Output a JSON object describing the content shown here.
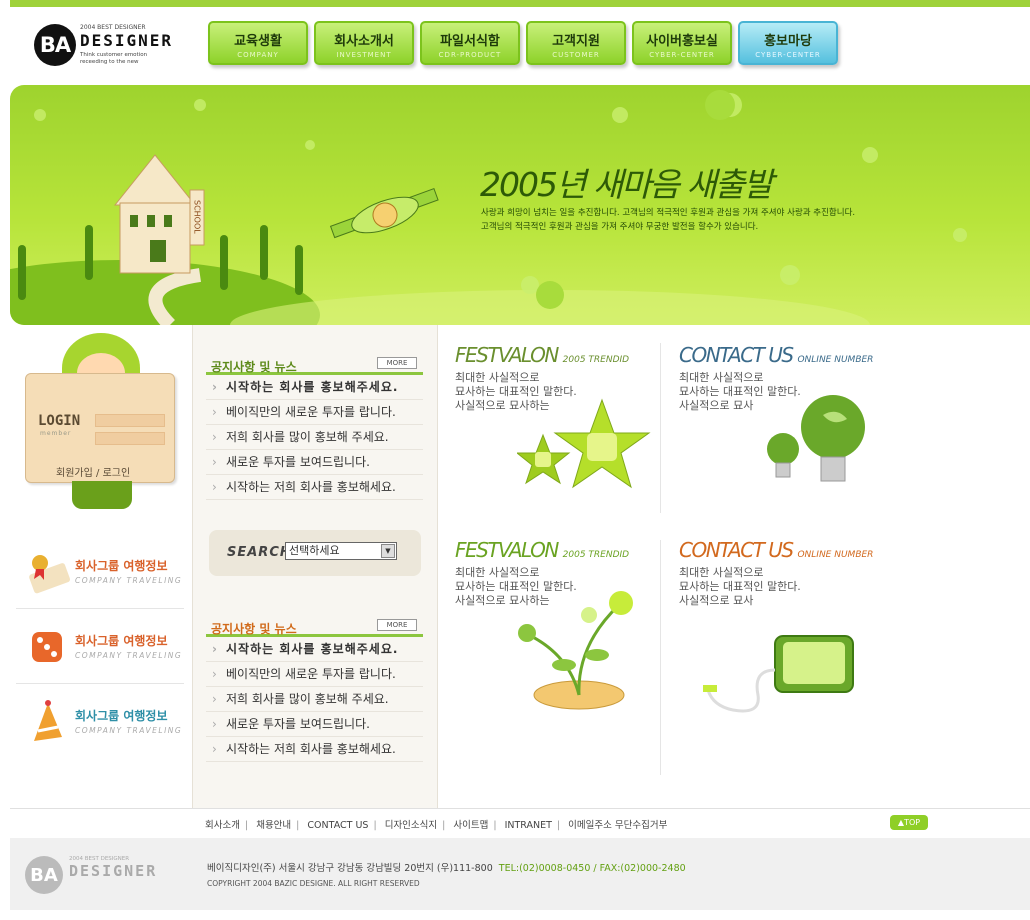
{
  "header": {
    "logo": {
      "mark": "BA",
      "small": "2004 BEST DESIGNER",
      "name": "DESIGNER",
      "tagline": "Think customer emotion receeding to the new"
    },
    "nav": [
      {
        "label": "교육생활",
        "sub": "COMPANY"
      },
      {
        "label": "회사소개서",
        "sub": "INVESTMENT"
      },
      {
        "label": "파일서식함",
        "sub": "CDR-PRODUCT"
      },
      {
        "label": "고객지원",
        "sub": "CUSTOMER"
      },
      {
        "label": "사이버홍보실",
        "sub": "CYBER-CENTER"
      },
      {
        "label": "홍보마당",
        "sub": "CYBER-CENTER"
      }
    ]
  },
  "banner": {
    "title": "2005년 새마음 새출발",
    "line1": "사랑과 희망이 넘치는 일을 추진합니다. 고객님의 적극적인 후원과 관심을 가져 주셔야 사랑과 추진합니다.",
    "line2": "고객님의 적극적인 후원과 관심을 가져 주셔야 무궁한 발전을 할수가 있습니다.",
    "sign": "SCHOOL"
  },
  "login": {
    "title": "LOGIN",
    "sub": "member",
    "join": "회원가입",
    "sep": "/",
    "login": "로그인"
  },
  "side_items": [
    {
      "title": "회사그룹 여행정보",
      "sub": "COMPANY TRAVELING"
    },
    {
      "title": "회사그룹 여행정보",
      "sub": "COMPANY TRAVELING"
    },
    {
      "title": "회사그룹 여행정보",
      "sub": "COMPANY TRAVELING"
    }
  ],
  "news1": {
    "title": "공지사항 및 뉴스",
    "more": "MORE",
    "items": [
      "시작하는 회사를 홍보해주세요.",
      "베이직만의 새로운 투자를 랍니다.",
      "저희 회사를 많이 홍보해 주세요.",
      "새로운 투자를 보여드립니다.",
      "시작하는 저희 회사를 홍보해세요."
    ]
  },
  "search": {
    "label": "SEARCH",
    "select_value": "선택하세요"
  },
  "news2": {
    "title": "공지사항 및 뉴스",
    "more": "MORE",
    "items": [
      "시작하는 회사를 홍보해주세요.",
      "베이직만의 새로운 투자를 랍니다.",
      "저희 회사를 많이 홍보해 주세요.",
      "새로운 투자를 보여드립니다.",
      "시작하는 저희 회사를 홍보해세요."
    ]
  },
  "promos": [
    {
      "head": "FESTVALON",
      "sub": "2005 TRENDID",
      "l1": "최대한 사실적으로",
      "l2": "묘사하는 대표적인 말한다.",
      "l3": "사실적으로 묘사하는",
      "color": "#6a8f2e"
    },
    {
      "head": "CONTACT US",
      "sub": "ONLINE NUMBER",
      "l1": "최대한 사실적으로",
      "l2": "묘사하는 대표적인 말한다.",
      "l3": "사실적으로 묘사",
      "color": "#3a6a8a"
    },
    {
      "head": "FESTVALON",
      "sub": "2005 TRENDID",
      "l1": "최대한 사실적으로",
      "l2": "묘사하는 대표적인 말한다.",
      "l3": "사실적으로 묘사하는",
      "color": "#6aa322"
    },
    {
      "head": "CONTACT US",
      "sub": "ONLINE NUMBER",
      "l1": "최대한 사실적으로",
      "l2": "묘사하는 대표적인 말한다.",
      "l3": "사실적으로 묘사",
      "color": "#d2691e"
    }
  ],
  "footer_nav": [
    "회사소개",
    "채용안내",
    "CONTACT US",
    "디자인소식지",
    "사이트맵",
    "INTRANET",
    "이메일주소 무단수집거부"
  ],
  "top_button": "TOP",
  "footer": {
    "logo_mark": "BA",
    "logo_small": "2004 BEST DESIGNER",
    "logo_name": "DESIGNER",
    "address": "베이직디자인(주) 서울시 강남구 강남동 강남빌딩 20번지 (우)111-800",
    "tel": "TEL:(02)0008-0450 / FAX:(02)000-2480",
    "copyright": "COPYRIGHT 2004 BAZIC DESIGNE. ALL RIGHT RESERVED"
  },
  "colors": {
    "brand_green": "#8cc63f",
    "accent_orange": "#d9622b",
    "accent_blue": "#2e8fa7"
  }
}
